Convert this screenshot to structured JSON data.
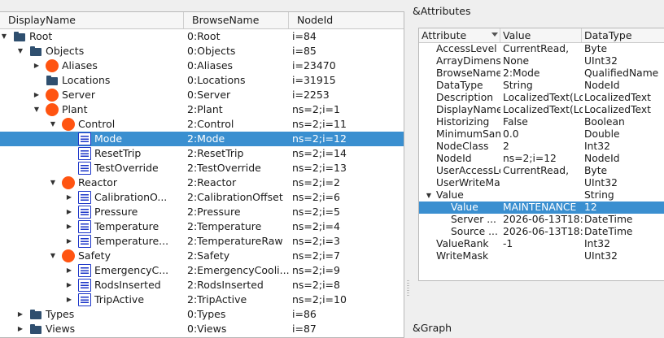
{
  "tree": {
    "columns": [
      "DisplayName",
      "BrowseName",
      "NodeId"
    ],
    "rows": [
      {
        "display": "Root",
        "browse": "0:Root",
        "nodeid": "i=84",
        "level": 0,
        "expand": "open",
        "icon": "folder",
        "selected": false
      },
      {
        "display": "Objects",
        "browse": "0:Objects",
        "nodeid": "i=85",
        "level": 1,
        "expand": "open",
        "icon": "folder",
        "selected": false
      },
      {
        "display": "Aliases",
        "browse": "0:Aliases",
        "nodeid": "i=23470",
        "level": 2,
        "expand": "closed",
        "icon": "object",
        "selected": false
      },
      {
        "display": "Locations",
        "browse": "0:Locations",
        "nodeid": "i=31915",
        "level": 2,
        "expand": "none",
        "icon": "folder",
        "selected": false
      },
      {
        "display": "Server",
        "browse": "0:Server",
        "nodeid": "i=2253",
        "level": 2,
        "expand": "closed",
        "icon": "object",
        "selected": false
      },
      {
        "display": "Plant",
        "browse": "2:Plant",
        "nodeid": "ns=2;i=1",
        "level": 2,
        "expand": "open",
        "icon": "object",
        "selected": false
      },
      {
        "display": "Control",
        "browse": "2:Control",
        "nodeid": "ns=2;i=11",
        "level": 3,
        "expand": "open",
        "icon": "object",
        "selected": false
      },
      {
        "display": "Mode",
        "browse": "2:Mode",
        "nodeid": "ns=2;i=12",
        "level": 4,
        "expand": "none",
        "icon": "variable",
        "selected": true
      },
      {
        "display": "ResetTrip",
        "browse": "2:ResetTrip",
        "nodeid": "ns=2;i=14",
        "level": 4,
        "expand": "none",
        "icon": "variable",
        "selected": false
      },
      {
        "display": "TestOverride",
        "browse": "2:TestOverride",
        "nodeid": "ns=2;i=13",
        "level": 4,
        "expand": "none",
        "icon": "variable",
        "selected": false
      },
      {
        "display": "Reactor",
        "browse": "2:Reactor",
        "nodeid": "ns=2;i=2",
        "level": 3,
        "expand": "open",
        "icon": "object",
        "selected": false
      },
      {
        "display": "CalibrationO...",
        "browse": "2:CalibrationOffset",
        "nodeid": "ns=2;i=6",
        "level": 4,
        "expand": "closed",
        "icon": "variable",
        "selected": false
      },
      {
        "display": "Pressure",
        "browse": "2:Pressure",
        "nodeid": "ns=2;i=5",
        "level": 4,
        "expand": "closed",
        "icon": "variable",
        "selected": false
      },
      {
        "display": "Temperature",
        "browse": "2:Temperature",
        "nodeid": "ns=2;i=4",
        "level": 4,
        "expand": "closed",
        "icon": "variable",
        "selected": false
      },
      {
        "display": "Temperature...",
        "browse": "2:TemperatureRaw",
        "nodeid": "ns=2;i=3",
        "level": 4,
        "expand": "closed",
        "icon": "variable",
        "selected": false
      },
      {
        "display": "Safety",
        "browse": "2:Safety",
        "nodeid": "ns=2;i=7",
        "level": 3,
        "expand": "open",
        "icon": "object",
        "selected": false
      },
      {
        "display": "EmergencyC...",
        "browse": "2:EmergencyCooli...",
        "nodeid": "ns=2;i=9",
        "level": 4,
        "expand": "closed",
        "icon": "variable",
        "selected": false
      },
      {
        "display": "RodsInserted",
        "browse": "2:RodsInserted",
        "nodeid": "ns=2;i=8",
        "level": 4,
        "expand": "closed",
        "icon": "variable",
        "selected": false
      },
      {
        "display": "TripActive",
        "browse": "2:TripActive",
        "nodeid": "ns=2;i=10",
        "level": 4,
        "expand": "closed",
        "icon": "variable",
        "selected": false
      },
      {
        "display": "Types",
        "browse": "0:Types",
        "nodeid": "i=86",
        "level": 1,
        "expand": "closed",
        "icon": "folder",
        "selected": false
      },
      {
        "display": "Views",
        "browse": "0:Views",
        "nodeid": "i=87",
        "level": 1,
        "expand": "closed",
        "icon": "folder",
        "selected": false
      }
    ]
  },
  "attributes": {
    "title": "&Attributes",
    "columns": [
      "Attribute",
      "Value",
      "DataType"
    ],
    "rows": [
      {
        "name": "AccessLevel",
        "value": "CurrentRead,",
        "type": "Byte",
        "level": 0,
        "expand": "none",
        "selected": false
      },
      {
        "name": "ArrayDimensions",
        "value": "None",
        "type": "UInt32",
        "level": 0,
        "expand": "none",
        "selected": false
      },
      {
        "name": "BrowseName",
        "value": "2:Mode",
        "type": "QualifiedName",
        "level": 0,
        "expand": "none",
        "selected": false
      },
      {
        "name": "DataType",
        "value": "String",
        "type": "NodeId",
        "level": 0,
        "expand": "none",
        "selected": false
      },
      {
        "name": "Description",
        "value": "LocalizedText(Lo",
        "type": "LocalizedText",
        "level": 0,
        "expand": "none",
        "selected": false
      },
      {
        "name": "DisplayName",
        "value": "LocalizedText(Lo",
        "type": "LocalizedText",
        "level": 0,
        "expand": "none",
        "selected": false
      },
      {
        "name": "Historizing",
        "value": "False",
        "type": "Boolean",
        "level": 0,
        "expand": "none",
        "selected": false
      },
      {
        "name": "MinimumSamplingInterval",
        "value": "0.0",
        "type": "Double",
        "level": 0,
        "expand": "none",
        "selected": false
      },
      {
        "name": "NodeClass",
        "value": "2",
        "type": "Int32",
        "level": 0,
        "expand": "none",
        "selected": false
      },
      {
        "name": "NodeId",
        "value": "ns=2;i=12",
        "type": "NodeId",
        "level": 0,
        "expand": "none",
        "selected": false
      },
      {
        "name": "UserAccessLevel",
        "value": "CurrentRead,",
        "type": "Byte",
        "level": 0,
        "expand": "none",
        "selected": false
      },
      {
        "name": "UserWriteMask",
        "value": "",
        "type": "UInt32",
        "level": 0,
        "expand": "none",
        "selected": false
      },
      {
        "name": "Value",
        "value": "",
        "type": "String",
        "level": 0,
        "expand": "open",
        "selected": false
      },
      {
        "name": "Value",
        "value": "MAINTENANCE",
        "type": "12",
        "level": 1,
        "expand": "none",
        "selected": true
      },
      {
        "name": "Server ...",
        "value": "2026-06-13T18:",
        "type": "DateTime",
        "level": 1,
        "expand": "none",
        "selected": false
      },
      {
        "name": "Source ...",
        "value": "2026-06-13T18:",
        "type": "DateTime",
        "level": 1,
        "expand": "none",
        "selected": false
      },
      {
        "name": "ValueRank",
        "value": "-1",
        "type": "Int32",
        "level": 0,
        "expand": "none",
        "selected": false
      },
      {
        "name": "WriteMask",
        "value": "",
        "type": "UInt32",
        "level": 0,
        "expand": "none",
        "selected": false
      }
    ]
  },
  "graph": {
    "title": "&Graph"
  },
  "colors": {
    "selection": "#3a8fd0",
    "object_icon": "#ff5411",
    "variable_icon": "#1b35c8",
    "folder_icon": "#2f4f6f"
  }
}
